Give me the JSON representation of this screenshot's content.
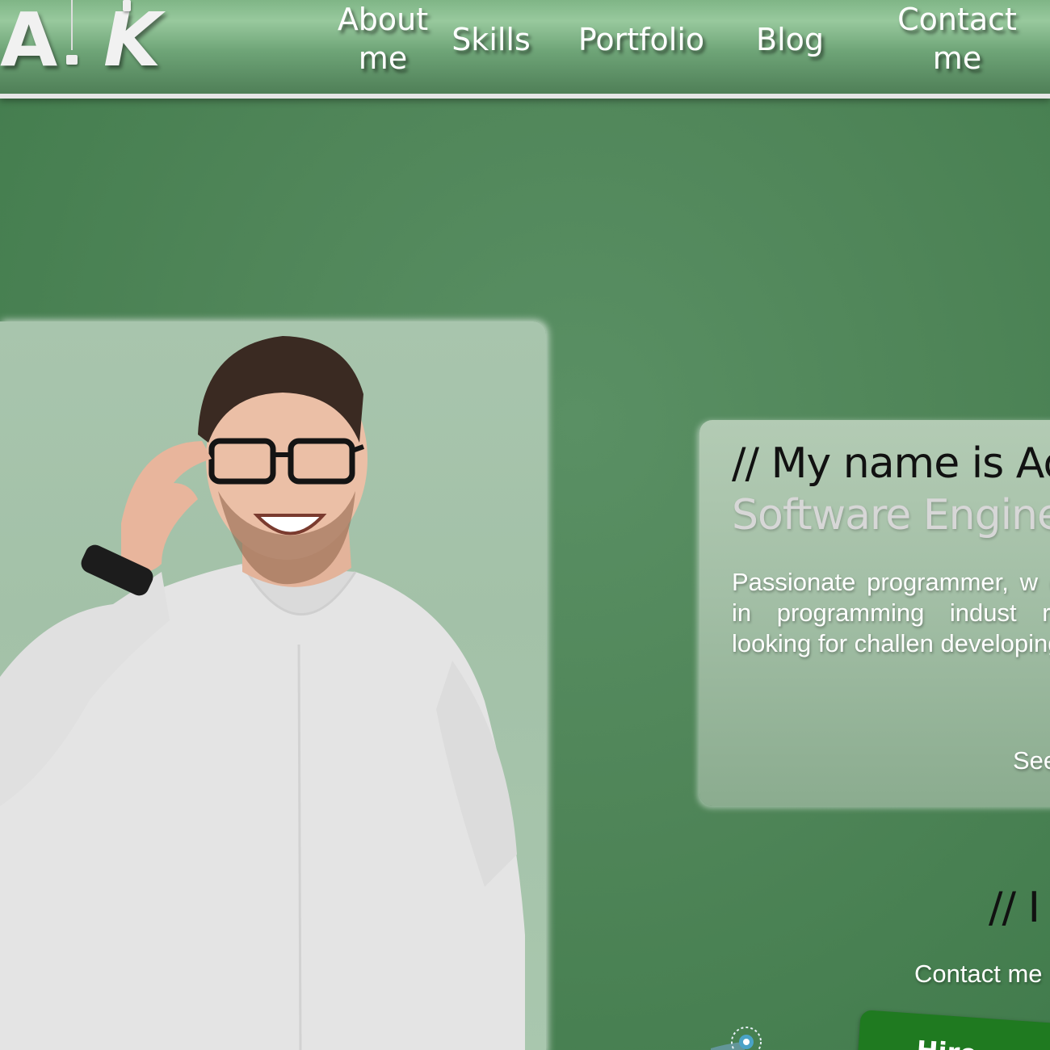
{
  "header": {
    "logo": {
      "letters": [
        "A",
        "K"
      ]
    },
    "nav": [
      {
        "line1": "About",
        "line2": "me"
      },
      {
        "line1": "Skills",
        "line2": ""
      },
      {
        "line1": "Portfolio",
        "line2": ""
      },
      {
        "line1": "Blog",
        "line2": ""
      },
      {
        "line1": "Contact",
        "line2": "me"
      }
    ]
  },
  "intro": {
    "heading": "// My name is Ad",
    "role": "Software Enginee",
    "description": "Passionate programmer, w ence in programming indust rently looking for challen developing",
    "see_more": "See"
  },
  "contact": {
    "heading": "// I",
    "subtitle": "Contact me",
    "hire_label": "Hire"
  },
  "colors": {
    "page_bg": "#4f8558",
    "header_bg": "#7fb586",
    "accent_button": "#1f7a20",
    "card_bg": "#a8c5ad"
  }
}
